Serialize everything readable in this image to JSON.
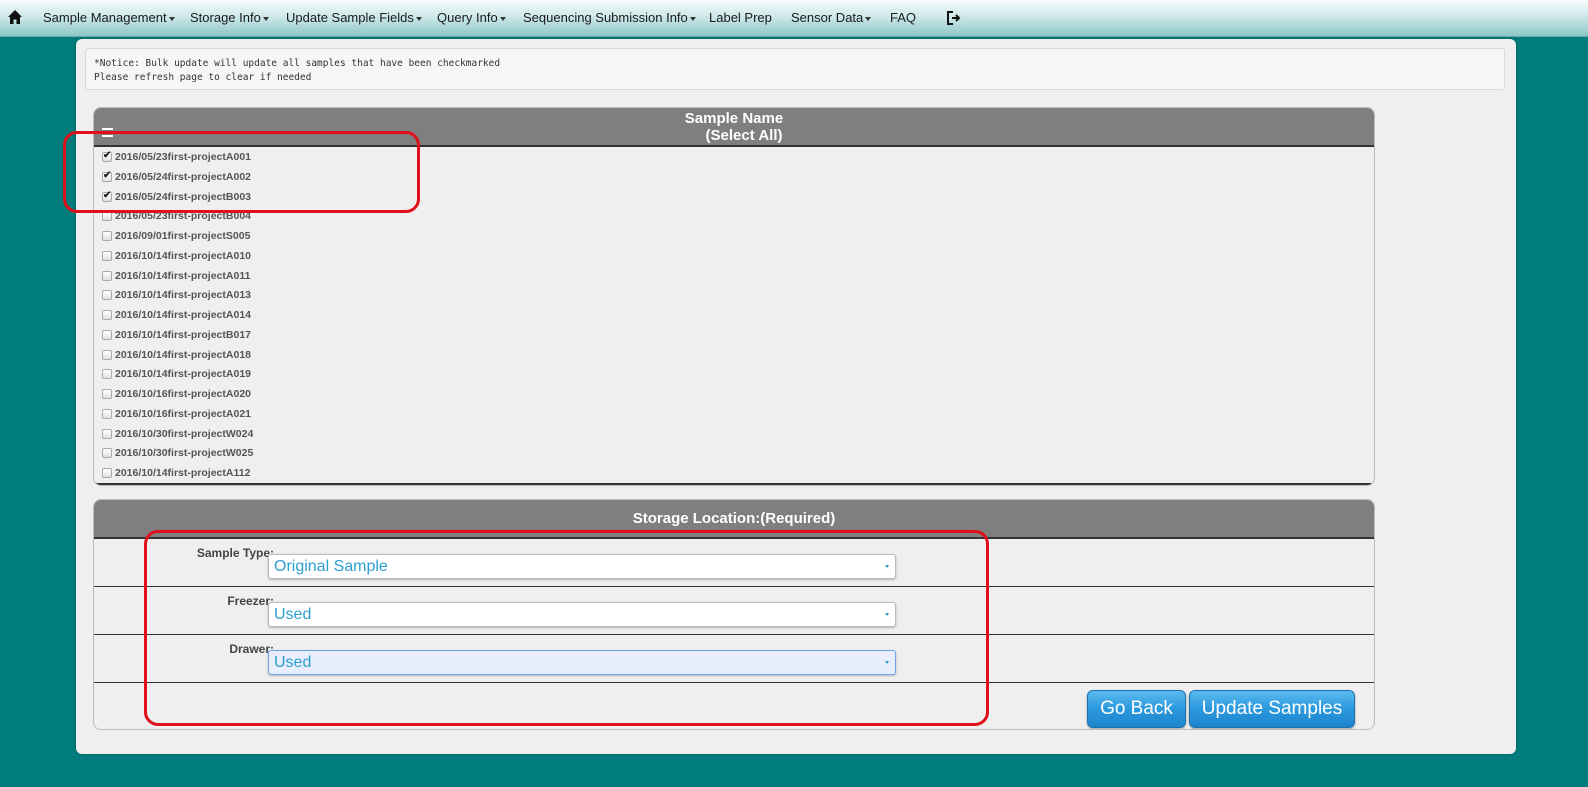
{
  "nav": {
    "items": [
      {
        "label": "Sample Management",
        "dropdown": true
      },
      {
        "label": "Storage Info",
        "dropdown": true
      },
      {
        "label": "Update Sample Fields",
        "dropdown": true
      },
      {
        "label": "Query Info",
        "dropdown": true
      },
      {
        "label": "Sequencing Submission Info",
        "dropdown": true
      },
      {
        "label": "Label Prep",
        "dropdown": false
      },
      {
        "label": "Sensor Data",
        "dropdown": true
      },
      {
        "label": "FAQ",
        "dropdown": false
      }
    ],
    "home_icon": "home-icon",
    "logout_icon": "logout-icon"
  },
  "notice": {
    "line1": "*Notice: Bulk update will update all samples that have been checkmarked",
    "line2": "Please refresh page to clear if needed"
  },
  "samples": {
    "header_title": "Sample Name",
    "header_select_all": "(Select All)",
    "items": [
      {
        "name": "2016/05/23first-projectA001",
        "checked": true
      },
      {
        "name": "2016/05/24first-projectA002",
        "checked": true
      },
      {
        "name": "2016/05/24first-projectB003",
        "checked": true
      },
      {
        "name": "2016/05/23first-projectB004",
        "checked": false
      },
      {
        "name": "2016/09/01first-projectS005",
        "checked": false
      },
      {
        "name": "2016/10/14first-projectA010",
        "checked": false
      },
      {
        "name": "2016/10/14first-projectA011",
        "checked": false
      },
      {
        "name": "2016/10/14first-projectA013",
        "checked": false
      },
      {
        "name": "2016/10/14first-projectA014",
        "checked": false
      },
      {
        "name": "2016/10/14first-projectB017",
        "checked": false
      },
      {
        "name": "2016/10/14first-projectA018",
        "checked": false
      },
      {
        "name": "2016/10/14first-projectA019",
        "checked": false
      },
      {
        "name": "2016/10/16first-projectA020",
        "checked": false
      },
      {
        "name": "2016/10/16first-projectA021",
        "checked": false
      },
      {
        "name": "2016/10/30first-projectW024",
        "checked": false
      },
      {
        "name": "2016/10/30first-projectW025",
        "checked": false
      },
      {
        "name": "2016/10/14first-projectA112",
        "checked": false
      }
    ]
  },
  "storage": {
    "header": "Storage Location:(Required)",
    "fields": [
      {
        "label": "Sample Type:",
        "value": "Original Sample"
      },
      {
        "label": "Freezer:",
        "value": "Used"
      },
      {
        "label": "Drawer:",
        "value": "Used"
      }
    ],
    "go_back_label": "Go Back",
    "update_label": "Update Samples"
  },
  "colors": {
    "background": "#017c7c",
    "panel_header": "#7f7f7f",
    "select_text": "#2c9fd0",
    "button_blue": "#2b98dd",
    "annotation_red": "#e0101a"
  }
}
